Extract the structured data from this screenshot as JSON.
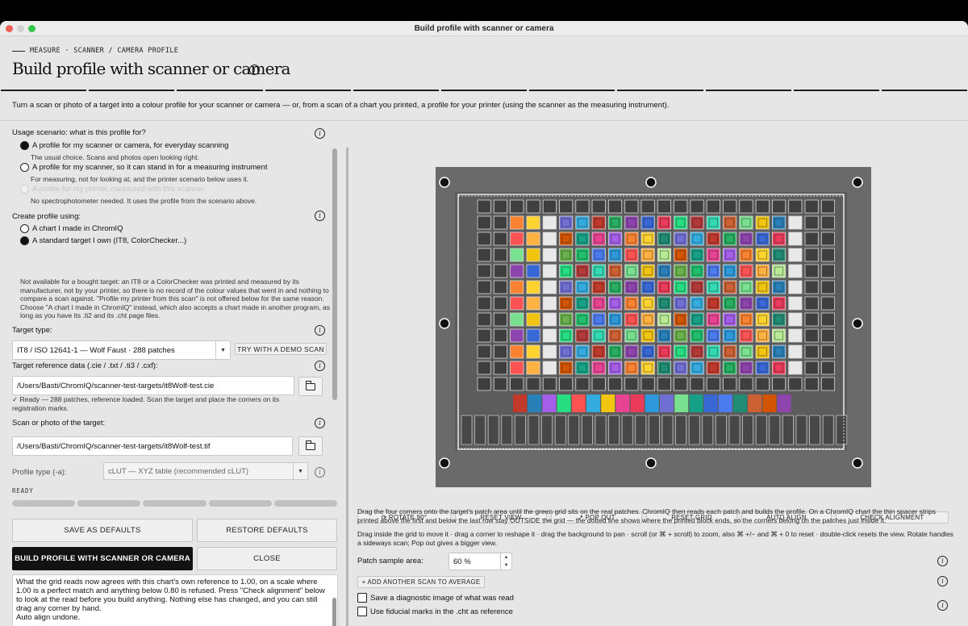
{
  "window": {
    "title": "Build profile with scanner or camera"
  },
  "breadcrumb": "MEASURE · SCANNER / CAMERA PROFILE",
  "page_title": "Build profile with scanner or camera",
  "intro": "Turn a scan or photo of a target into a colour profile for your scanner or camera — or, from a scan of a chart you printed, a profile for your printer (using the scanner as the measuring instrument).",
  "usage": {
    "label": "Usage scenario: what is this profile for?",
    "options": [
      {
        "label": "A profile for my scanner or camera, for everyday scanning",
        "hint": "The usual choice. Scans and photos open looking right.",
        "selected": true,
        "enabled": true
      },
      {
        "label": "A profile for my scanner, so it can stand in for a measuring instrument",
        "hint": "For measuring, not for looking at, and the printer scenario below uses it.",
        "selected": false,
        "enabled": true
      },
      {
        "label": "A profile for my printer, measured with this scanner",
        "hint": "No spectrophotometer needed. It uses the profile from the scenario above.",
        "selected": false,
        "enabled": false
      }
    ]
  },
  "create_using": {
    "label": "Create profile using:",
    "options": [
      {
        "label": "A chart I made in ChromIQ",
        "selected": false
      },
      {
        "label": "A standard target I own (IT8, ColorChecker...)",
        "selected": true
      }
    ],
    "note": "Not available for a bought target: an IT8 or a ColorChecker was printed and measured by its manufacturer, not by your printer, so there is no record of the colour values that went in and nothing to compare a scan against. \"Profile my printer from this scan\" is not offered below for the same reason. Choose \"A chart I made in ChromIQ\" instead, which also accepts a chart made in another program, as long as you have its .ti2 and its .cht page files."
  },
  "target_type": {
    "label": "Target type:",
    "value": "IT8 / ISO 12641-1 — Wolf Faust · 288 patches",
    "demo_button": "TRY WITH A DEMO SCAN"
  },
  "reference": {
    "label": "Target reference data (.cie / .txt / .ti3 / .cxf):",
    "value": "/Users/Basti/ChromIQ/scanner-test-targets/it8Wolf-test.cie",
    "status": "✓ Ready — 288 patches, reference loaded. Scan the target and place the corners on its registration marks."
  },
  "scan": {
    "label": "Scan or photo of the target:",
    "value": "/Users/Basti/ChromIQ/scanner-test-targets/it8Wolf-test.tif"
  },
  "profile_type": {
    "label": "Profile type (-a):",
    "value": "cLUT — XYZ table (recommended cLUT)"
  },
  "status": {
    "text": "READY",
    "progress": 0
  },
  "buttons": {
    "save_defaults": "SAVE AS DEFAULTS",
    "restore_defaults": "RESTORE DEFAULTS",
    "build": "BUILD PROFILE WITH SCANNER OR CAMERA",
    "close": "CLOSE"
  },
  "log": "What the grid reads now agrees with this chart's own reference to 1.00, on a scale where 1.00 is a perfect match and anything below 0.80 is refused. Press \"Check alignment\" below to look at the read before you build anything. Nothing else has changed, and you can still drag any corner by hand.\nAuto align undone.",
  "toolbar": {
    "rotate": "⟳ ROTATE 90°",
    "reset_view": "RESET VIEW",
    "pop_out": "↗ POP OUT",
    "reset_grid": "RESET GRID",
    "auto_align": "AUTO ALIGN",
    "check_alignment": "CHECK ALIGNMENT"
  },
  "help1": "Drag the four corners onto the target's patch area until the green grid sits on the real patches. ChromIQ then reads each patch and builds the profile. On a ChromIQ chart the thin spacer strips printed above the first and below the last row stay OUTSIDE the grid — the dotted line shows where the printed block ends, so the corners belong on the patches just inside it.",
  "help2": "Drag inside the grid to move it · drag a corner to reshape it · drag the background to pan · scroll (or ⌘ + scroll) to zoom, also ⌘ +/− and ⌘ + 0 to reset · double-click resets the view. Rotate handles a sideways scan; Pop out gives a bigger view.",
  "patch_sample": {
    "label": "Patch sample area:",
    "value": "60 %"
  },
  "add_scan": "+ ADD ANOTHER SCAN TO AVERAGE",
  "checkboxes": [
    {
      "label": "Save a diagnostic image of what was read",
      "checked": false
    },
    {
      "label": "Use fiducial marks in the .cht as reference",
      "checked": false
    }
  ],
  "icons": {
    "info": "info-icon",
    "folder": "folder-icon",
    "dropdown": "chevron-down-icon",
    "handle": "corner-handle-icon"
  },
  "colors": {
    "accent_dark": "#121212",
    "window_bg": "#e6e6e6",
    "canvas_bg": "#6a6a6a",
    "grid_line": "#d8d8d8"
  }
}
